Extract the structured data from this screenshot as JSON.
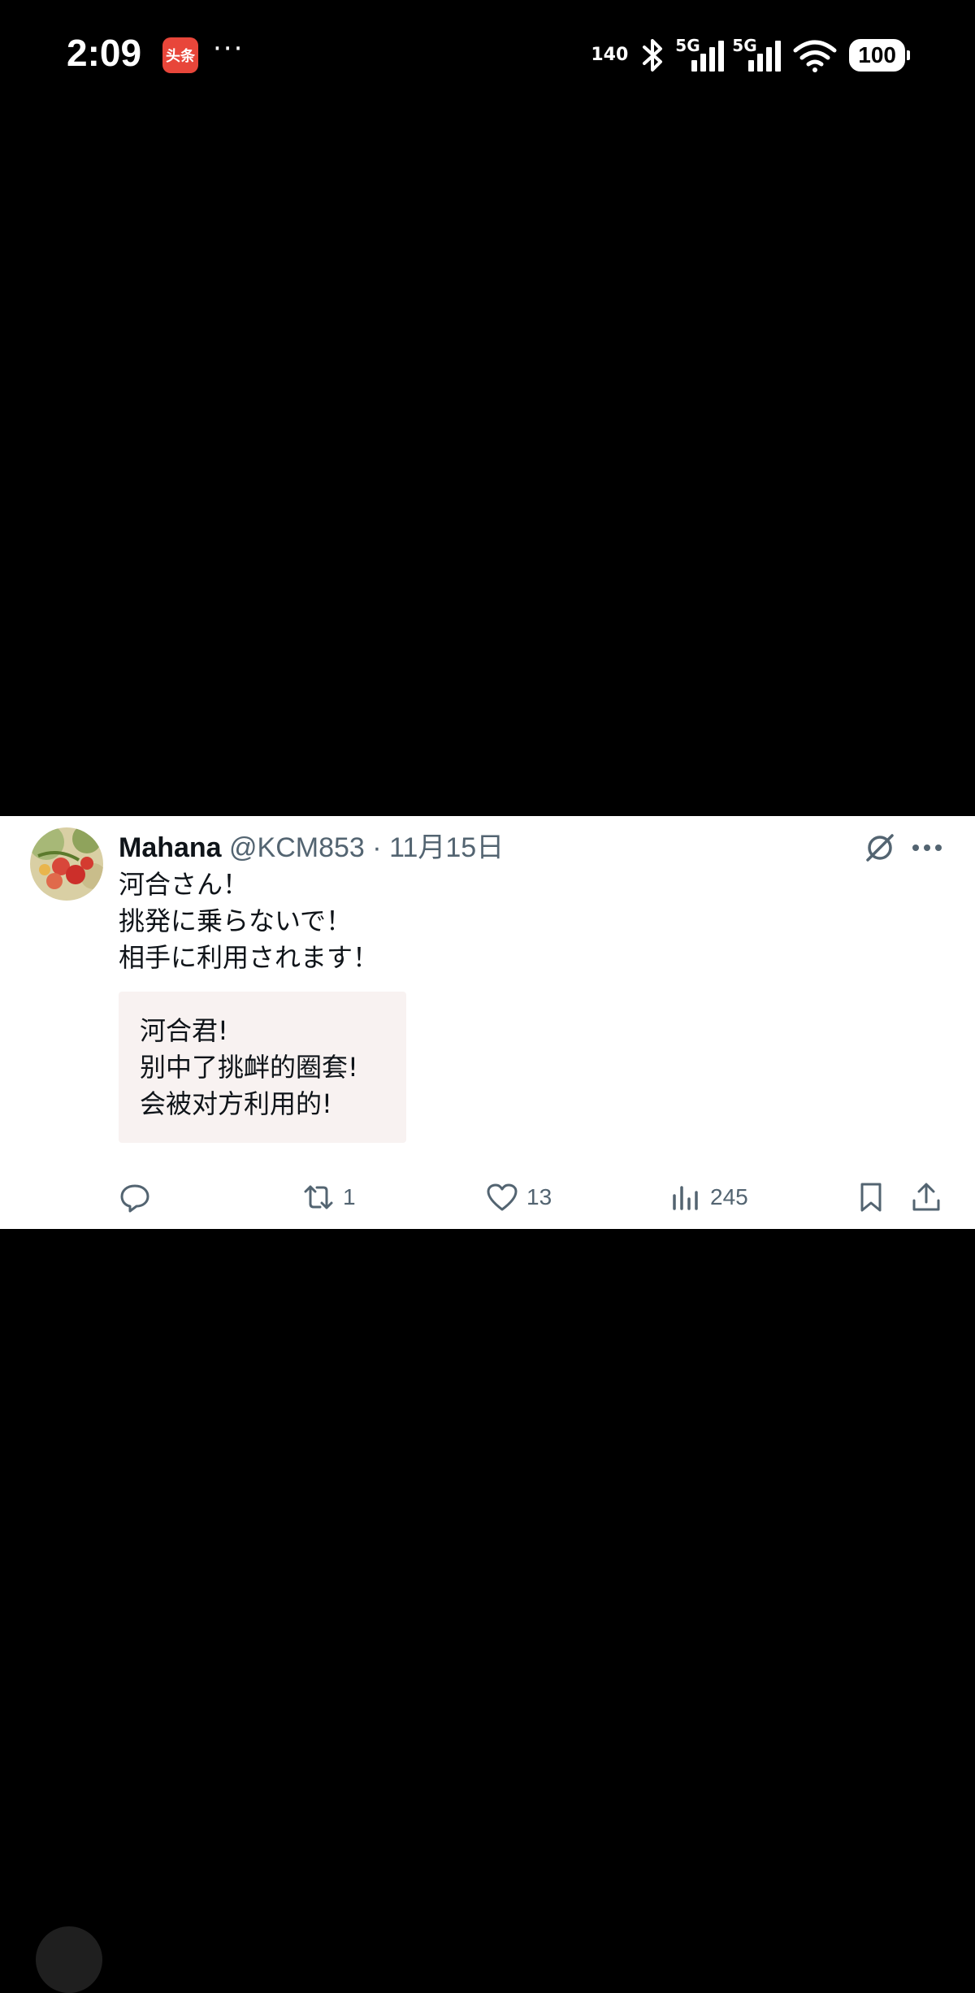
{
  "status_bar": {
    "time": "2:09",
    "app_badge": "头条",
    "more": "···",
    "net_speed": "140",
    "network_1": "5G",
    "network_2": "5G",
    "battery": "100"
  },
  "tweet": {
    "author_name": "Mahana",
    "author_handle": "@KCM853",
    "separator": "·",
    "date": "11月15日",
    "text_lines": [
      "河合さん！",
      "挑発に乗らないで！",
      "相手に利用されます！"
    ],
    "translation_lines": [
      "河合君!",
      "别中了挑衅的圈套!",
      "会被对方利用的!"
    ],
    "actions": {
      "reply_count": "",
      "retweet_count": "1",
      "like_count": "13",
      "views_count": "245"
    }
  },
  "colors": {
    "background": "#000000",
    "card": "#ffffff",
    "text": "#0f1419",
    "muted": "#536471",
    "translation_bg": "#f8f2f1"
  }
}
